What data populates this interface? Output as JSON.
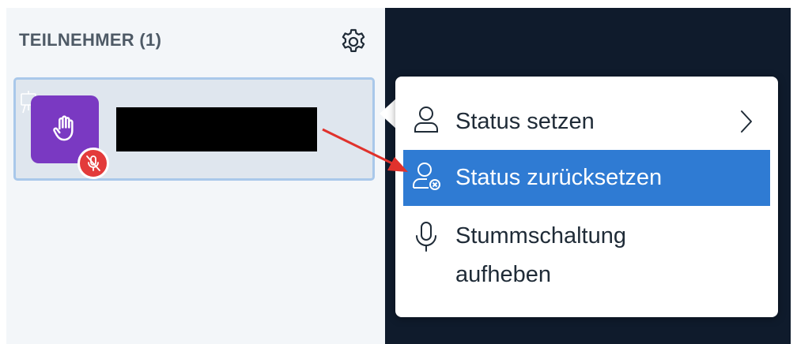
{
  "participants_panel": {
    "header": "TEILNEHMER (1)",
    "settings_icon": "gear-icon",
    "participant": {
      "name": "",
      "avatar_color": "#7a39c2",
      "avatar_icon": "raised-hand-icon",
      "presenter_icon": "presenter-icon",
      "status_badge_icon": "microphone-muted-icon",
      "status_badge_color": "#e33b3b"
    }
  },
  "context_menu": {
    "items": [
      {
        "label": "Status setzen",
        "icon": "user-icon",
        "has_submenu": true,
        "submenu_icon": "chevron-right-icon",
        "highlighted": false
      },
      {
        "label": "Status zurücksetzen",
        "icon": "user-clear-icon",
        "has_submenu": false,
        "highlighted": true
      },
      {
        "label": "Stummschaltung aufheben",
        "icon": "microphone-icon",
        "has_submenu": false,
        "highlighted": false
      }
    ],
    "highlight_color": "#2f7bd3"
  },
  "annotation": {
    "arrow_color": "#e0322c"
  }
}
